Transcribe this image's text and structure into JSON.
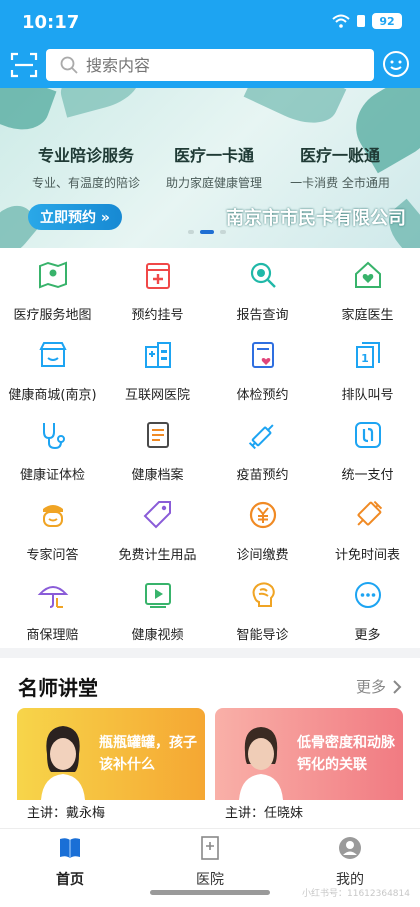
{
  "status": {
    "time": "10:17",
    "battery": "92"
  },
  "search": {
    "placeholder": "搜索内容"
  },
  "banner": {
    "columns": [
      {
        "title": "专业陪诊服务",
        "subtitle": "专业、有温度的陪诊"
      },
      {
        "title": "医疗一卡通",
        "subtitle": "助力家庭健康管理"
      },
      {
        "title": "医疗一账通",
        "subtitle": "一卡消费 全市通用"
      }
    ],
    "cta": "立即预约 »",
    "brand": "南京市市民卡有限公司"
  },
  "grid": [
    {
      "label": "医疗服务地图",
      "icon": "map-pin-icon",
      "color": "#38b36b"
    },
    {
      "label": "预约挂号",
      "icon": "calendar-plus-icon",
      "color": "#f04848"
    },
    {
      "label": "报告查询",
      "icon": "search-report-icon",
      "color": "#20b8a8"
    },
    {
      "label": "家庭医生",
      "icon": "home-heart-icon",
      "color": "#38b36b"
    },
    {
      "label": "健康商城(南京)",
      "icon": "store-icon",
      "color": "#1da4f2"
    },
    {
      "label": "互联网医院",
      "icon": "hospital-icon",
      "color": "#1da4f2"
    },
    {
      "label": "体检预约",
      "icon": "checkup-icon",
      "color": "#2f6fe0"
    },
    {
      "label": "排队叫号",
      "icon": "queue-icon",
      "color": "#1da4f2"
    },
    {
      "label": "健康证体检",
      "icon": "stethoscope-icon",
      "color": "#1da4f2"
    },
    {
      "label": "健康档案",
      "icon": "health-record-icon",
      "color": "#f08a24"
    },
    {
      "label": "疫苗预约",
      "icon": "syringe-icon",
      "color": "#1da4f2"
    },
    {
      "label": "统一支付",
      "icon": "unified-pay-icon",
      "color": "#1da4f2"
    },
    {
      "label": "专家问答",
      "icon": "expert-icon",
      "color": "#f0a424"
    },
    {
      "label": "免费计生用品",
      "icon": "tag-icon",
      "color": "#8a5cd8"
    },
    {
      "label": "诊间缴费",
      "icon": "yuan-coin-icon",
      "color": "#f08a24"
    },
    {
      "label": "计免时间表",
      "icon": "vaccine-schedule-icon",
      "color": "#f08a24"
    },
    {
      "label": "商保理赔",
      "icon": "umbrella-icon",
      "color": "#8a5cd8"
    },
    {
      "label": "健康视频",
      "icon": "video-icon",
      "color": "#38b36b"
    },
    {
      "label": "智能导诊",
      "icon": "brain-icon",
      "color": "#f0a424"
    },
    {
      "label": "更多",
      "icon": "more-icon",
      "color": "#1da4f2"
    }
  ],
  "lectures": {
    "heading": "名师讲堂",
    "more": "更多",
    "cards": [
      {
        "title": "瓶瓶罐罐，孩子该补什么",
        "presenter": "主讲：戴永梅",
        "color": "#f5c330"
      },
      {
        "title": "低骨密度和动脉钙化的关联",
        "presenter": "主讲：任晓妹",
        "color": "#f48a8a"
      }
    ]
  },
  "nav": [
    {
      "label": "首页",
      "icon": "home-book-icon"
    },
    {
      "label": "医院",
      "icon": "hospital-nav-icon"
    },
    {
      "label": "我的",
      "icon": "profile-icon"
    }
  ],
  "watermark": "小红书号：11612364814"
}
